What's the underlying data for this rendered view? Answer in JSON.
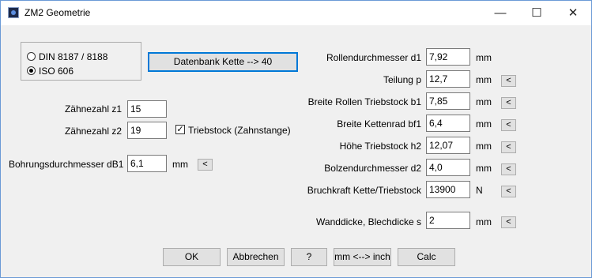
{
  "window": {
    "title": "ZM2 Geometrie",
    "controls": {
      "minimize": "—",
      "maximize": "☐",
      "close": "✕"
    }
  },
  "standard": {
    "option1": "DIN 8187 / 8188",
    "option2": "ISO 606",
    "selected": "ISO 606"
  },
  "db_button": "Datenbank Kette  -->  40",
  "left": {
    "z1_label": "Zähnezahl z1",
    "z1_value": "15",
    "z2_label": "Zähnezahl z2",
    "z2_value": "19",
    "triebstock_label": "Triebstock (Zahnstange)",
    "triebstock_checked": true,
    "db1_label": "Bohrungsdurchmesser dB1",
    "db1_value": "6,1",
    "db1_unit": "mm",
    "db1_btn": "<"
  },
  "right": [
    {
      "label": "Rollendurchmesser d1",
      "value": "7,92",
      "unit": "mm",
      "btn": ""
    },
    {
      "label": "Teilung p",
      "value": "12,7",
      "unit": "mm",
      "btn": "<"
    },
    {
      "label": "Breite Rollen Triebstock b1",
      "value": "7,85",
      "unit": "mm",
      "btn": "<"
    },
    {
      "label": "Breite Kettenrad bf1",
      "value": "6,4",
      "unit": "mm",
      "btn": "<"
    },
    {
      "label": "Höhe Triebstock h2",
      "value": "12,07",
      "unit": "mm",
      "btn": "<"
    },
    {
      "label": "Bolzendurchmesser d2",
      "value": "4,0",
      "unit": "mm",
      "btn": "<"
    },
    {
      "label": "Bruchkraft Kette/Triebstock",
      "value": "13900",
      "unit": "N",
      "btn": "<"
    },
    {
      "label": "Wanddicke, Blechdicke s",
      "value": "2",
      "unit": "mm",
      "btn": "<"
    }
  ],
  "buttons": {
    "ok": "OK",
    "abbrechen": "Abbrechen",
    "help": "?",
    "mm_inch": "mm <--> inch",
    "calc": "Calc"
  }
}
